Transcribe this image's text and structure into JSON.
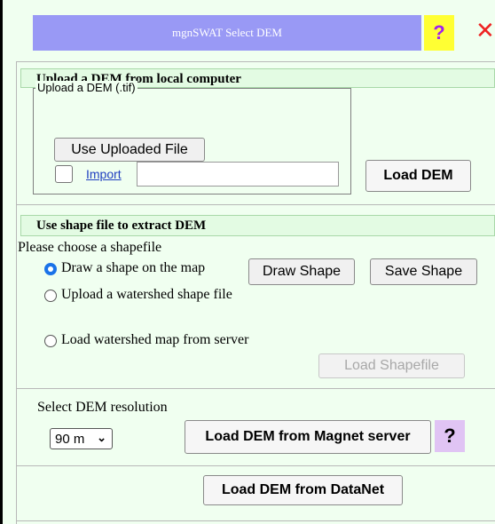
{
  "window": {
    "title": "mgnSWAT Select DEM",
    "help_icon": "question-mark-icon",
    "close_icon": "close-icon"
  },
  "upload_section": {
    "heading": "Upload a DEM from local computer",
    "fieldset_legend": "Upload a DEM (.tif)",
    "use_uploaded_button": "Use Uploaded File",
    "import_link": "Import",
    "file_value": "",
    "load_dem_button": "Load DEM"
  },
  "shape_section": {
    "heading": "Use shape file to extract DEM",
    "prompt": "Please choose a shapefile",
    "options": [
      {
        "label": "Draw a shape on the map",
        "selected": true
      },
      {
        "label": "Upload a watershed shape file",
        "selected": false
      },
      {
        "label": "Load watershed map from server",
        "selected": false
      }
    ],
    "draw_shape_button": "Draw Shape",
    "save_shape_button": "Save Shape",
    "load_shapefile_button": "Load Shapefile"
  },
  "resolution_section": {
    "label": "Select DEM resolution",
    "selected_resolution": "90 m",
    "load_magnet_button": "Load DEM from Magnet server",
    "help_icon": "question-mark-icon"
  },
  "datanet_section": {
    "load_datanet_button": "Load DEM from DataNet"
  },
  "colors": {
    "panel_bg": "#f0fff0",
    "title_bg": "#9999f5",
    "help_bg": "#ffff33",
    "close_color": "#ee2222",
    "help2_bg": "#e0c4f4",
    "radio_accent": "#1a73e8"
  }
}
